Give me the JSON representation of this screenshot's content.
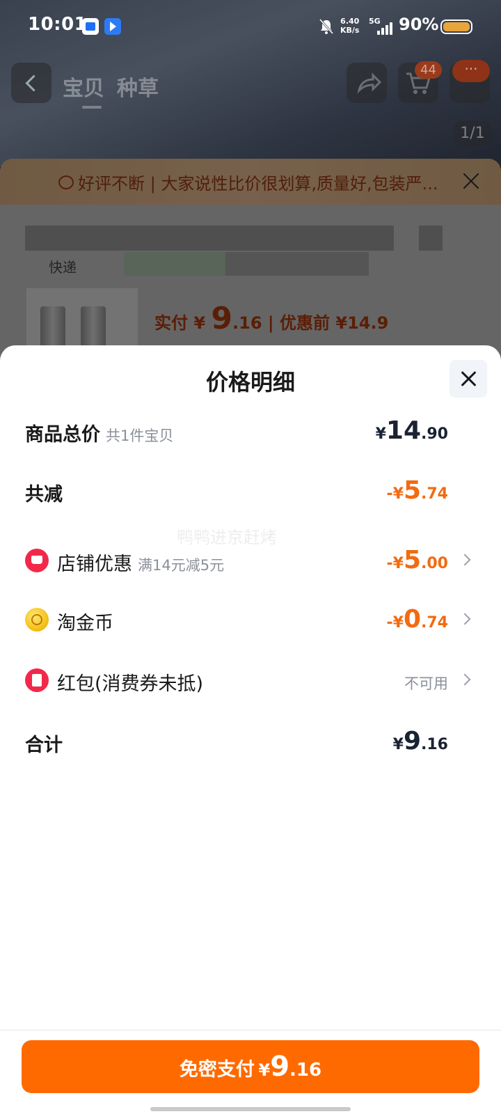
{
  "status_bar": {
    "time": "10:01",
    "net_speed_value": "6.40",
    "net_speed_unit": "KB/s",
    "network": "5G",
    "battery_percent": "90%"
  },
  "background_page": {
    "tabs": [
      "宝贝",
      "种草"
    ],
    "cart_badge": "44",
    "more_label": "···",
    "image_counter": "1/1",
    "review_banner": "好评不断 | 大家说性比价很划算,质量好,包装严...",
    "delivery_label": "快递",
    "price_line": {
      "prefix": "实付",
      "currency": "¥",
      "integer": "9",
      "decimal": ".16",
      "original_label": "| 优惠前 ¥14.9"
    }
  },
  "sheet": {
    "title": "价格明细",
    "watermark": "鸭鸭进京赶烤",
    "rows": {
      "total": {
        "label": "商品总价",
        "sub": "共1件宝贝",
        "currency": "¥",
        "integer": "14",
        "decimal": ".90"
      },
      "reduction": {
        "label": "共减",
        "currency": "-¥",
        "integer": "5",
        "decimal": ".74"
      },
      "shop_discount": {
        "icon": "shop-discount-icon",
        "label": "店铺优惠",
        "sub": "满14元减5元",
        "currency": "-¥",
        "integer": "5",
        "decimal": ".00"
      },
      "taojin_coin": {
        "icon": "coin-icon",
        "label": "淘金币",
        "currency": "-¥",
        "integer": "0",
        "decimal": ".74"
      },
      "red_packet": {
        "icon": "red-packet-icon",
        "label": "红包(消费券未抵)",
        "status": "不可用"
      },
      "sum": {
        "label": "合计",
        "currency": "¥",
        "integer": "9",
        "decimal": ".16"
      }
    },
    "pay_button": {
      "label": "免密支付",
      "currency": "¥",
      "integer": "9",
      "decimal": ".16"
    }
  },
  "colors": {
    "accent_orange": "#ff6a00",
    "discount_orange": "#f26b10",
    "shop_red": "#f2284b"
  }
}
